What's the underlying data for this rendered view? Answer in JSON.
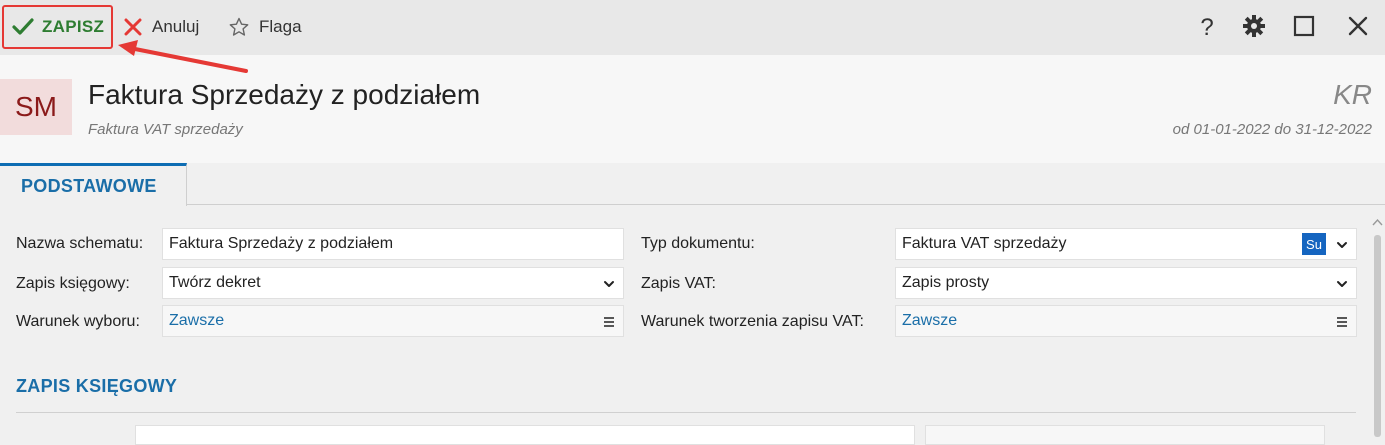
{
  "toolbar": {
    "save_label": "ZAPISZ",
    "cancel_label": "Anuluj",
    "flag_label": "Flaga",
    "help_label": "?"
  },
  "header": {
    "avatar": "SM",
    "title": "Faktura Sprzedaży z podziałem",
    "subtitle": "Faktura VAT sprzedaży",
    "code": "KR",
    "period": "od 01-01-2022 do 31-12-2022"
  },
  "tabs": [
    {
      "label": "PODSTAWOWE",
      "active": true
    }
  ],
  "form": {
    "schema_name_label": "Nazwa schematu:",
    "schema_name_value": "Faktura Sprzedaży z podziałem",
    "doc_type_label": "Typ dokumentu:",
    "doc_type_value": "Faktura VAT sprzedaży",
    "doc_type_badge": "Su",
    "entry_label": "Zapis księgowy:",
    "entry_value": "Twórz dekret",
    "vat_entry_label": "Zapis VAT:",
    "vat_entry_value": "Zapis prosty",
    "condition_label": "Warunek wyboru:",
    "condition_value": "Zawsze",
    "vat_condition_label": "Warunek tworzenia zapisu VAT:",
    "vat_condition_value": "Zawsze"
  },
  "section": {
    "title": "ZAPIS KSIĘGOWY"
  },
  "colors": {
    "accent": "#1a6ea8",
    "save_green": "#2e7d32",
    "highlight_red": "#e53935",
    "cancel_red": "#e53935",
    "avatar_bg": "#f2dcdc",
    "avatar_fg": "#8b1a1a"
  },
  "icons": [
    "check-icon",
    "close-icon",
    "star-icon",
    "help-icon",
    "gear-icon",
    "maximize-icon",
    "window-close-icon",
    "chevron-down-icon",
    "menu-icon",
    "arrow-annotation"
  ]
}
